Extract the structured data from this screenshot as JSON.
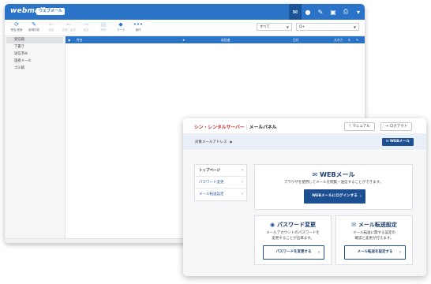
{
  "webmail": {
    "logo": "webmail",
    "badge": "ウェブメール",
    "header_icons": [
      "mail-icon",
      "user-icon",
      "tools-icon",
      "contacts-icon",
      "print-icon",
      "menu-icon"
    ],
    "toolbar": [
      {
        "icon": "refresh-icon",
        "label": "受信/更新",
        "glyph": "⟳",
        "dim": false
      },
      {
        "icon": "compose-icon",
        "label": "新規作成",
        "glyph": "✎",
        "dim": false
      },
      {
        "icon": "reply-icon",
        "label": "返信",
        "glyph": "↩",
        "dim": true
      },
      {
        "icon": "reply-all-icon",
        "label": "全員に返信",
        "glyph": "⇐",
        "dim": true
      },
      {
        "icon": "forward-icon",
        "label": "転送",
        "glyph": "↪",
        "dim": true
      },
      {
        "icon": "delete-icon",
        "label": "削除",
        "glyph": "▤",
        "dim": true
      },
      {
        "icon": "tag-icon",
        "label": "マーク",
        "glyph": "◆",
        "dim": false
      },
      {
        "icon": "more-icon",
        "label": "操作",
        "glyph": "•••",
        "dim": false
      }
    ],
    "filter_select": "すべて",
    "search_placeholder": "Q+",
    "folders": [
      "受信箱",
      "下書き",
      "送信済み",
      "迷惑メール",
      "ゴミ箱"
    ],
    "list_columns": {
      "subject": "件名",
      "sender": "送信者",
      "date": "日付",
      "size": "大きさ"
    }
  },
  "panel": {
    "brand_red": "シン・レンタルサーバー",
    "brand_rest": "メールパネル",
    "manual_label": "マニュアル",
    "logout_label": "ログアウト",
    "target_label": "対象メールアドレス",
    "webmail_button": "WEBメール",
    "nav": [
      {
        "label": "トップページ",
        "active": true
      },
      {
        "label": "パスワード変更",
        "active": false
      },
      {
        "label": "メール転送設定",
        "active": false
      }
    ],
    "webmail_card": {
      "title": "WEBメール",
      "desc": "ブラウザを使用してメールを閲覧・送信することができます。",
      "button": "WEBメールにログインする"
    },
    "password_card": {
      "title": "パスワード変更",
      "desc1": "メールアカウントのパスワードを",
      "desc2": "変更することが出来ます。",
      "button": "パスワードを変更する"
    },
    "forward_card": {
      "title": "メール転送設定",
      "desc1": "メール転送に関する設定の",
      "desc2": "確認と変更が行えます。",
      "button": "メール転送を設定する"
    }
  },
  "colors": {
    "accent_blue": "#2a73c6",
    "navy": "#1d4f93",
    "brand_red": "#d0282e"
  }
}
